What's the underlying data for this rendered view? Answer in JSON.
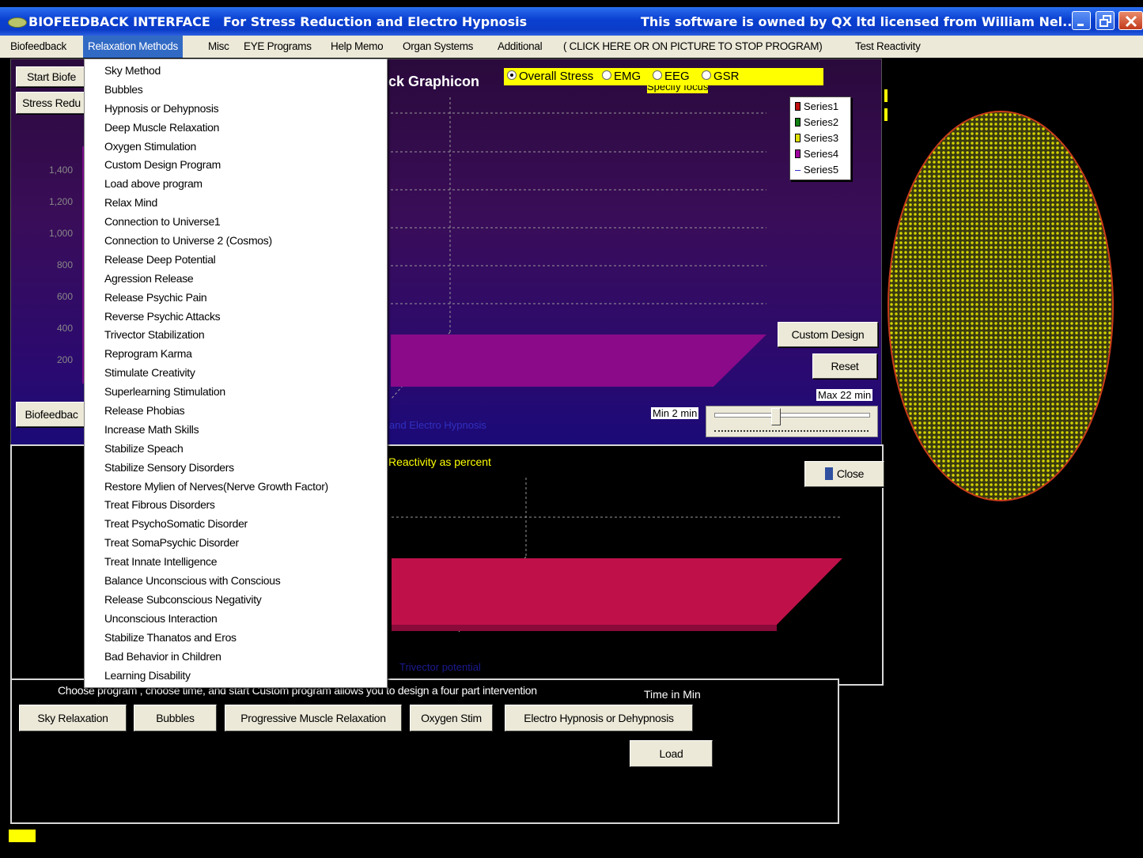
{
  "window": {
    "title_app": "BIOFEEDBACK INTERFACE",
    "title_sub": "For Stress Reduction and Electro Hypnosis",
    "title_owner": "This software is owned by QX ltd licensed from William Nel..."
  },
  "menubar": [
    "Biofeedback",
    "Relaxation Methods",
    "Misc",
    "EYE Programs",
    "Help Memo",
    "Organ Systems",
    "Additional",
    "( CLICK HERE OR ON PICTURE TO STOP PROGRAM)",
    "Test Reactivity"
  ],
  "dropdown": [
    "Sky Method",
    "Bubbles",
    "Hypnosis or Dehypnosis",
    "Deep Muscle Relaxation",
    "Oxygen Stimulation",
    "Custom Design Program",
    "Load above program",
    "Relax Mind",
    "Connection to Universe1",
    "Connection to Universe 2 (Cosmos)",
    "Release Deep Potential",
    "Agression Release",
    "Release Psychic Pain",
    "Reverse Psychic Attacks",
    "Trivector Stabilization",
    "Reprogram Karma",
    "Stimulate Creativity",
    "Superlearning Stimulation",
    "Release Phobias",
    "Increase Math Skills",
    "Stabilize Speach",
    "Stabilize Sensory Disorders",
    "Restore Mylien of Nerves(Nerve Growth Factor)",
    "Treat Fibrous Disorders",
    "Treat PsychoSomatic Disorder",
    "Treat SomaPsychic Disorder",
    "Treat Innate Intelligence",
    "Balance Unconscious with Conscious",
    "Release Subconscious Negativity",
    "Unconscious Interaction",
    "Stabilize Thanatos and Eros",
    "Bad Behavior in Children",
    "Learning Disability"
  ],
  "top_panel": {
    "start_button": "Start Biofe",
    "stress_button": "Stress Redu",
    "biofeedback_button": "Biofeedbac",
    "graph_title": "ck Graphicon",
    "specify_focus": "Specify focus",
    "radios": [
      "Overall Stress",
      "EMG",
      "EEG",
      "GSR"
    ],
    "selected_radio": "Overall Stress",
    "y_ticks": [
      "1,400",
      "1,200",
      "1,000",
      "800",
      "600",
      "400",
      "200"
    ],
    "legend": [
      {
        "name": "Series1",
        "color": "#c01010"
      },
      {
        "name": "Series2",
        "color": "#108010"
      },
      {
        "name": "Series3",
        "color": "#e0e000"
      },
      {
        "name": "Series4",
        "color": "#a000a0"
      },
      {
        "name": "Series5",
        "color": "#1010c0"
      }
    ],
    "custom_design_button": "Custom Design",
    "custom_design_hotkey": "D",
    "reset_button": "Reset",
    "max_label": "Max 22 min",
    "min_label": "Min 2 min",
    "footer_text": "and Electro Hypnosis"
  },
  "mid_panel": {
    "reactivity_label": "Reactivity as percent",
    "close_button": "Close",
    "trivector_label": "Trivector potential"
  },
  "bottom_panel": {
    "instructions": "Choose program , choose time, and start   Custom program allows you to design a four part intervention",
    "time_label": "Time in Min",
    "buttons": [
      {
        "label": "Sky Relaxation",
        "name": "sky-relaxation-button"
      },
      {
        "label": "Bubbles",
        "name": "bubbles-button"
      },
      {
        "label": "Progressive Muscle Relaxation",
        "name": "progressive-muscle-relaxation-button"
      },
      {
        "label": "Oxygen Stim",
        "name": "oxygen-stim-button"
      },
      {
        "label": "Electro Hypnosis or Dehypnosis",
        "name": "electro-hypnosis-button"
      }
    ],
    "load_button": "Load"
  }
}
